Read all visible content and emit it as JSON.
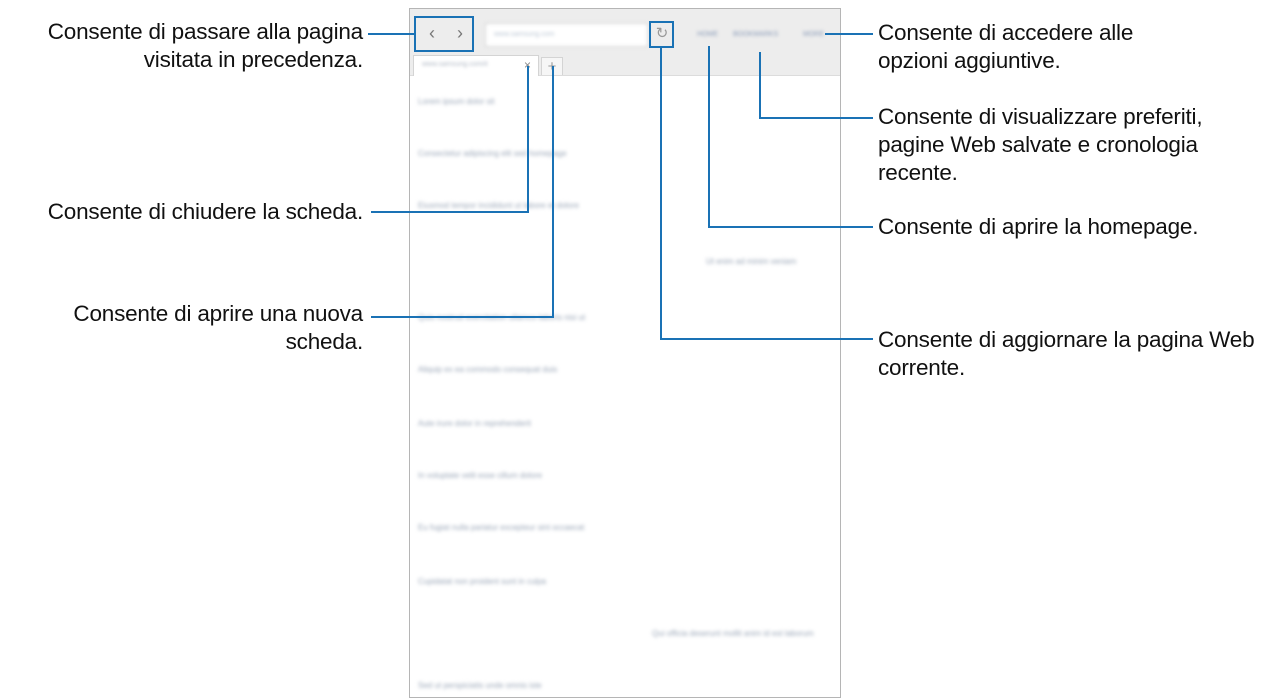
{
  "callouts": {
    "back": "Consente di passare alla pagina visitata in precedenza.",
    "close_tab": "Consente di chiudere la scheda.",
    "new_tab": "Consente di aprire una nuova scheda.",
    "more_options": "Consente di accedere alle opzioni aggiuntive.",
    "bookmarks": "Consente di visualizzare preferiti, pagine Web salvate e cronologia recente.",
    "home": "Consente di aprire la homepage.",
    "refresh": "Consente di aggiornare la pagina Web corrente."
  },
  "browser": {
    "back_glyph": "‹",
    "forward_glyph": "›",
    "url": "www.samsung.com",
    "reload_glyph": "↻",
    "home_link": "HOME",
    "bookmarks_link": "BOOKMARKS",
    "more_link": "MORE",
    "tab_title": "www.samsung.com/it",
    "tab_close_glyph": "×",
    "new_tab_glyph": "+",
    "content_lines": [
      "Lorem ipsum dolor sit",
      "Consectetur adipiscing elit sed homepage",
      "Eiusmod tempor incididunt ut labore et dolore",
      "Ut enim ad minim veniam",
      "Quis nostrud exercitation ullamco laboris nisi ut",
      "Aliquip ex ea commodo consequat duis",
      "Aute irure dolor in reprehenderit",
      "In voluptate velit esse cillum dolore",
      "Eu fugiat nulla pariatur excepteur sint occaecat",
      "Cupidatat non proident sunt in culpa",
      "Qui officia deserunt mollit anim id est laborum",
      "Sed ut perspiciatis unde omnis iste"
    ]
  }
}
